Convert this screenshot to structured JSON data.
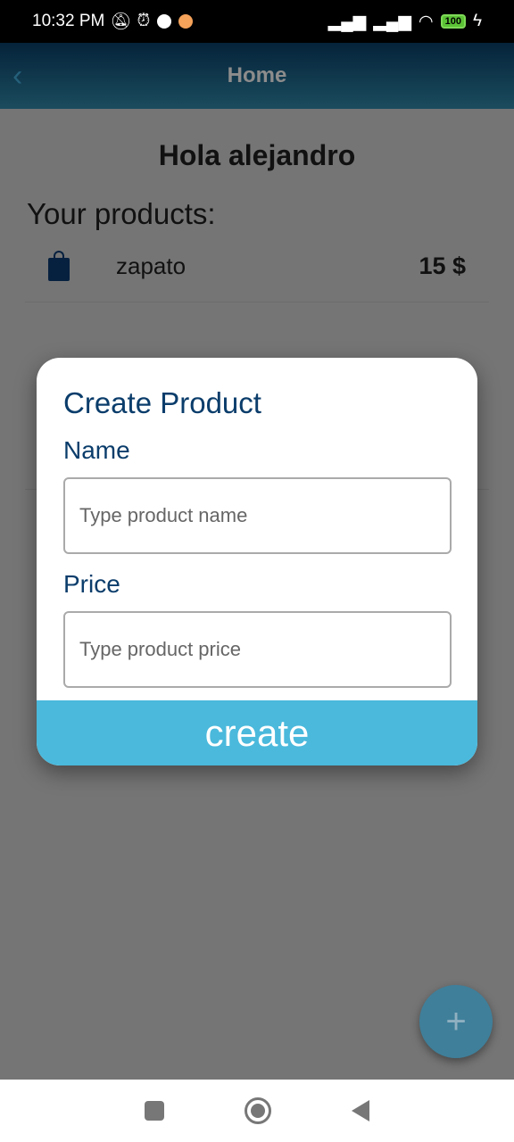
{
  "status_bar": {
    "time": "10:32 PM",
    "battery": "100"
  },
  "app_bar": {
    "title": "Home"
  },
  "main": {
    "greeting": "Hola alejandro",
    "products_heading": "Your products:",
    "products": [
      {
        "name": "zapato",
        "price": "15 $"
      }
    ]
  },
  "modal": {
    "title": "Create Product",
    "name_label": "Name",
    "name_placeholder": "Type product name",
    "price_label": "Price",
    "price_placeholder": "Type product price",
    "create_label": "create"
  },
  "fab": {
    "label": "+"
  },
  "colors": {
    "accent": "#4ab9dc",
    "title": "#0b3d6b"
  }
}
